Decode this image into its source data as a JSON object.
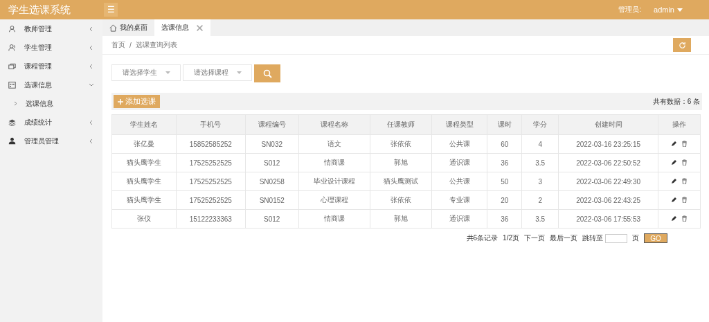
{
  "app_title": "学生选课系统",
  "header": {
    "menu_icon": "☰",
    "user_label": "管理员:",
    "user_name": "admin"
  },
  "sidebar": {
    "items": [
      {
        "label": "教师管理",
        "expanded": false
      },
      {
        "label": "学生管理",
        "expanded": false
      },
      {
        "label": "课程管理",
        "expanded": false
      },
      {
        "label": "选课信息",
        "expanded": true,
        "children": [
          {
            "label": "选课信息"
          }
        ]
      },
      {
        "label": "成绩统计",
        "expanded": false
      },
      {
        "label": "管理员管理",
        "expanded": false
      }
    ]
  },
  "tabs": [
    {
      "label": "我的桌面",
      "kind": "home",
      "selected": false
    },
    {
      "label": "选课信息",
      "kind": "closable",
      "selected": true
    }
  ],
  "breadcrumb": {
    "items": [
      "首页",
      "选课查询列表"
    ],
    "separator": "/"
  },
  "filters": [
    {
      "placeholder": "请选择学生"
    },
    {
      "placeholder": "请选择课程"
    }
  ],
  "add_button": "添加选课",
  "total": "共有数据：6 条",
  "table": {
    "columns": [
      "学生姓名",
      "手机号",
      "课程编号",
      "课程名称",
      "任课教师",
      "课程类型",
      "课时",
      "学分",
      "创建时间",
      "操作"
    ],
    "rows": [
      [
        "张亿曼",
        "15852585252",
        "SN032",
        "语文",
        "张依依",
        "公共课",
        "60",
        "4",
        "2022-03-16 23:25:15"
      ],
      [
        "猫头鹰学生",
        "17525252525",
        "S012",
        "情商课",
        "郭旭",
        "通识课",
        "36",
        "3.5",
        "2022-03-06 22:50:52"
      ],
      [
        "猫头鹰学生",
        "17525252525",
        "SN0258",
        "毕业设计课程",
        "猫头鹰测试",
        "公共课",
        "50",
        "3",
        "2022-03-06 22:49:30"
      ],
      [
        "猫头鹰学生",
        "17525252525",
        "SN0152",
        "心理课程",
        "张依依",
        "专业课",
        "20",
        "2",
        "2022-03-06 22:43:25"
      ],
      [
        "张仪",
        "15122233363",
        "S012",
        "情商课",
        "郭旭",
        "通识课",
        "36",
        "3.5",
        "2022-03-06 17:55:53"
      ]
    ]
  },
  "pagination": {
    "summary": "共6条记录",
    "page": "1/2页",
    "next": "下一页",
    "last": "最后一页",
    "jump_label": "跳转至",
    "page_unit": "页",
    "go": "GO"
  }
}
